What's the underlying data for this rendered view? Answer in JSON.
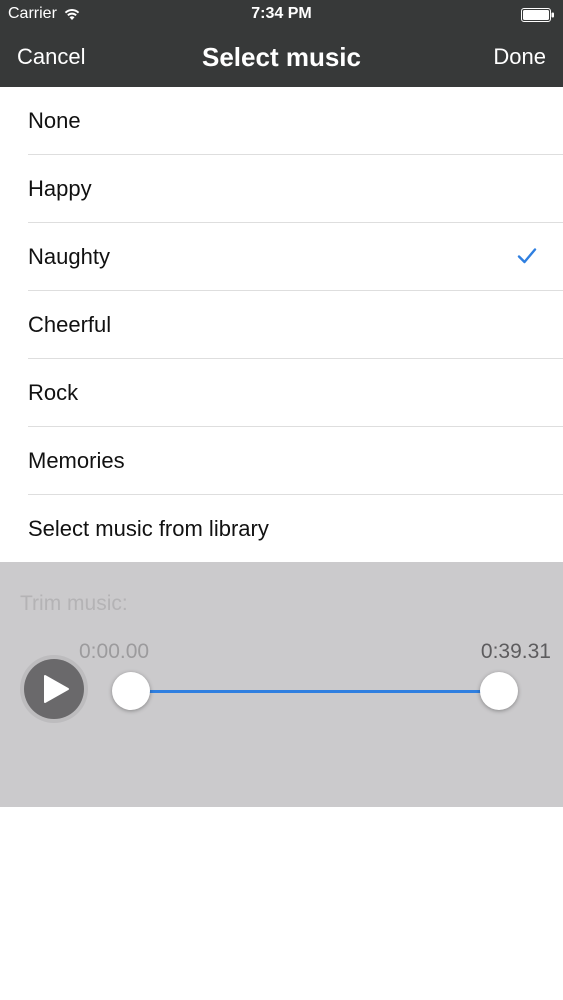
{
  "status_bar": {
    "carrier": "Carrier",
    "time": "7:34 PM",
    "icons": [
      "wifi-icon",
      "battery-icon"
    ]
  },
  "nav": {
    "cancel_label": "Cancel",
    "title": "Select music",
    "done_label": "Done"
  },
  "music_list": {
    "items": [
      {
        "label": "None",
        "selected": false
      },
      {
        "label": "Happy",
        "selected": false
      },
      {
        "label": "Naughty",
        "selected": true
      },
      {
        "label": "Cheerful",
        "selected": false
      },
      {
        "label": "Rock",
        "selected": false
      },
      {
        "label": "Memories",
        "selected": false
      },
      {
        "label": "Select music from library",
        "selected": false
      }
    ],
    "selected_icon": "checkmark-icon"
  },
  "trim": {
    "label": "Trim music:",
    "start_time": "0:00.00",
    "end_time": "0:39.31",
    "play_icon": "play-icon"
  },
  "colors": {
    "nav_background": "#373939",
    "accent": "#2f7fe0",
    "trim_panel_background": "#cbcacc"
  }
}
